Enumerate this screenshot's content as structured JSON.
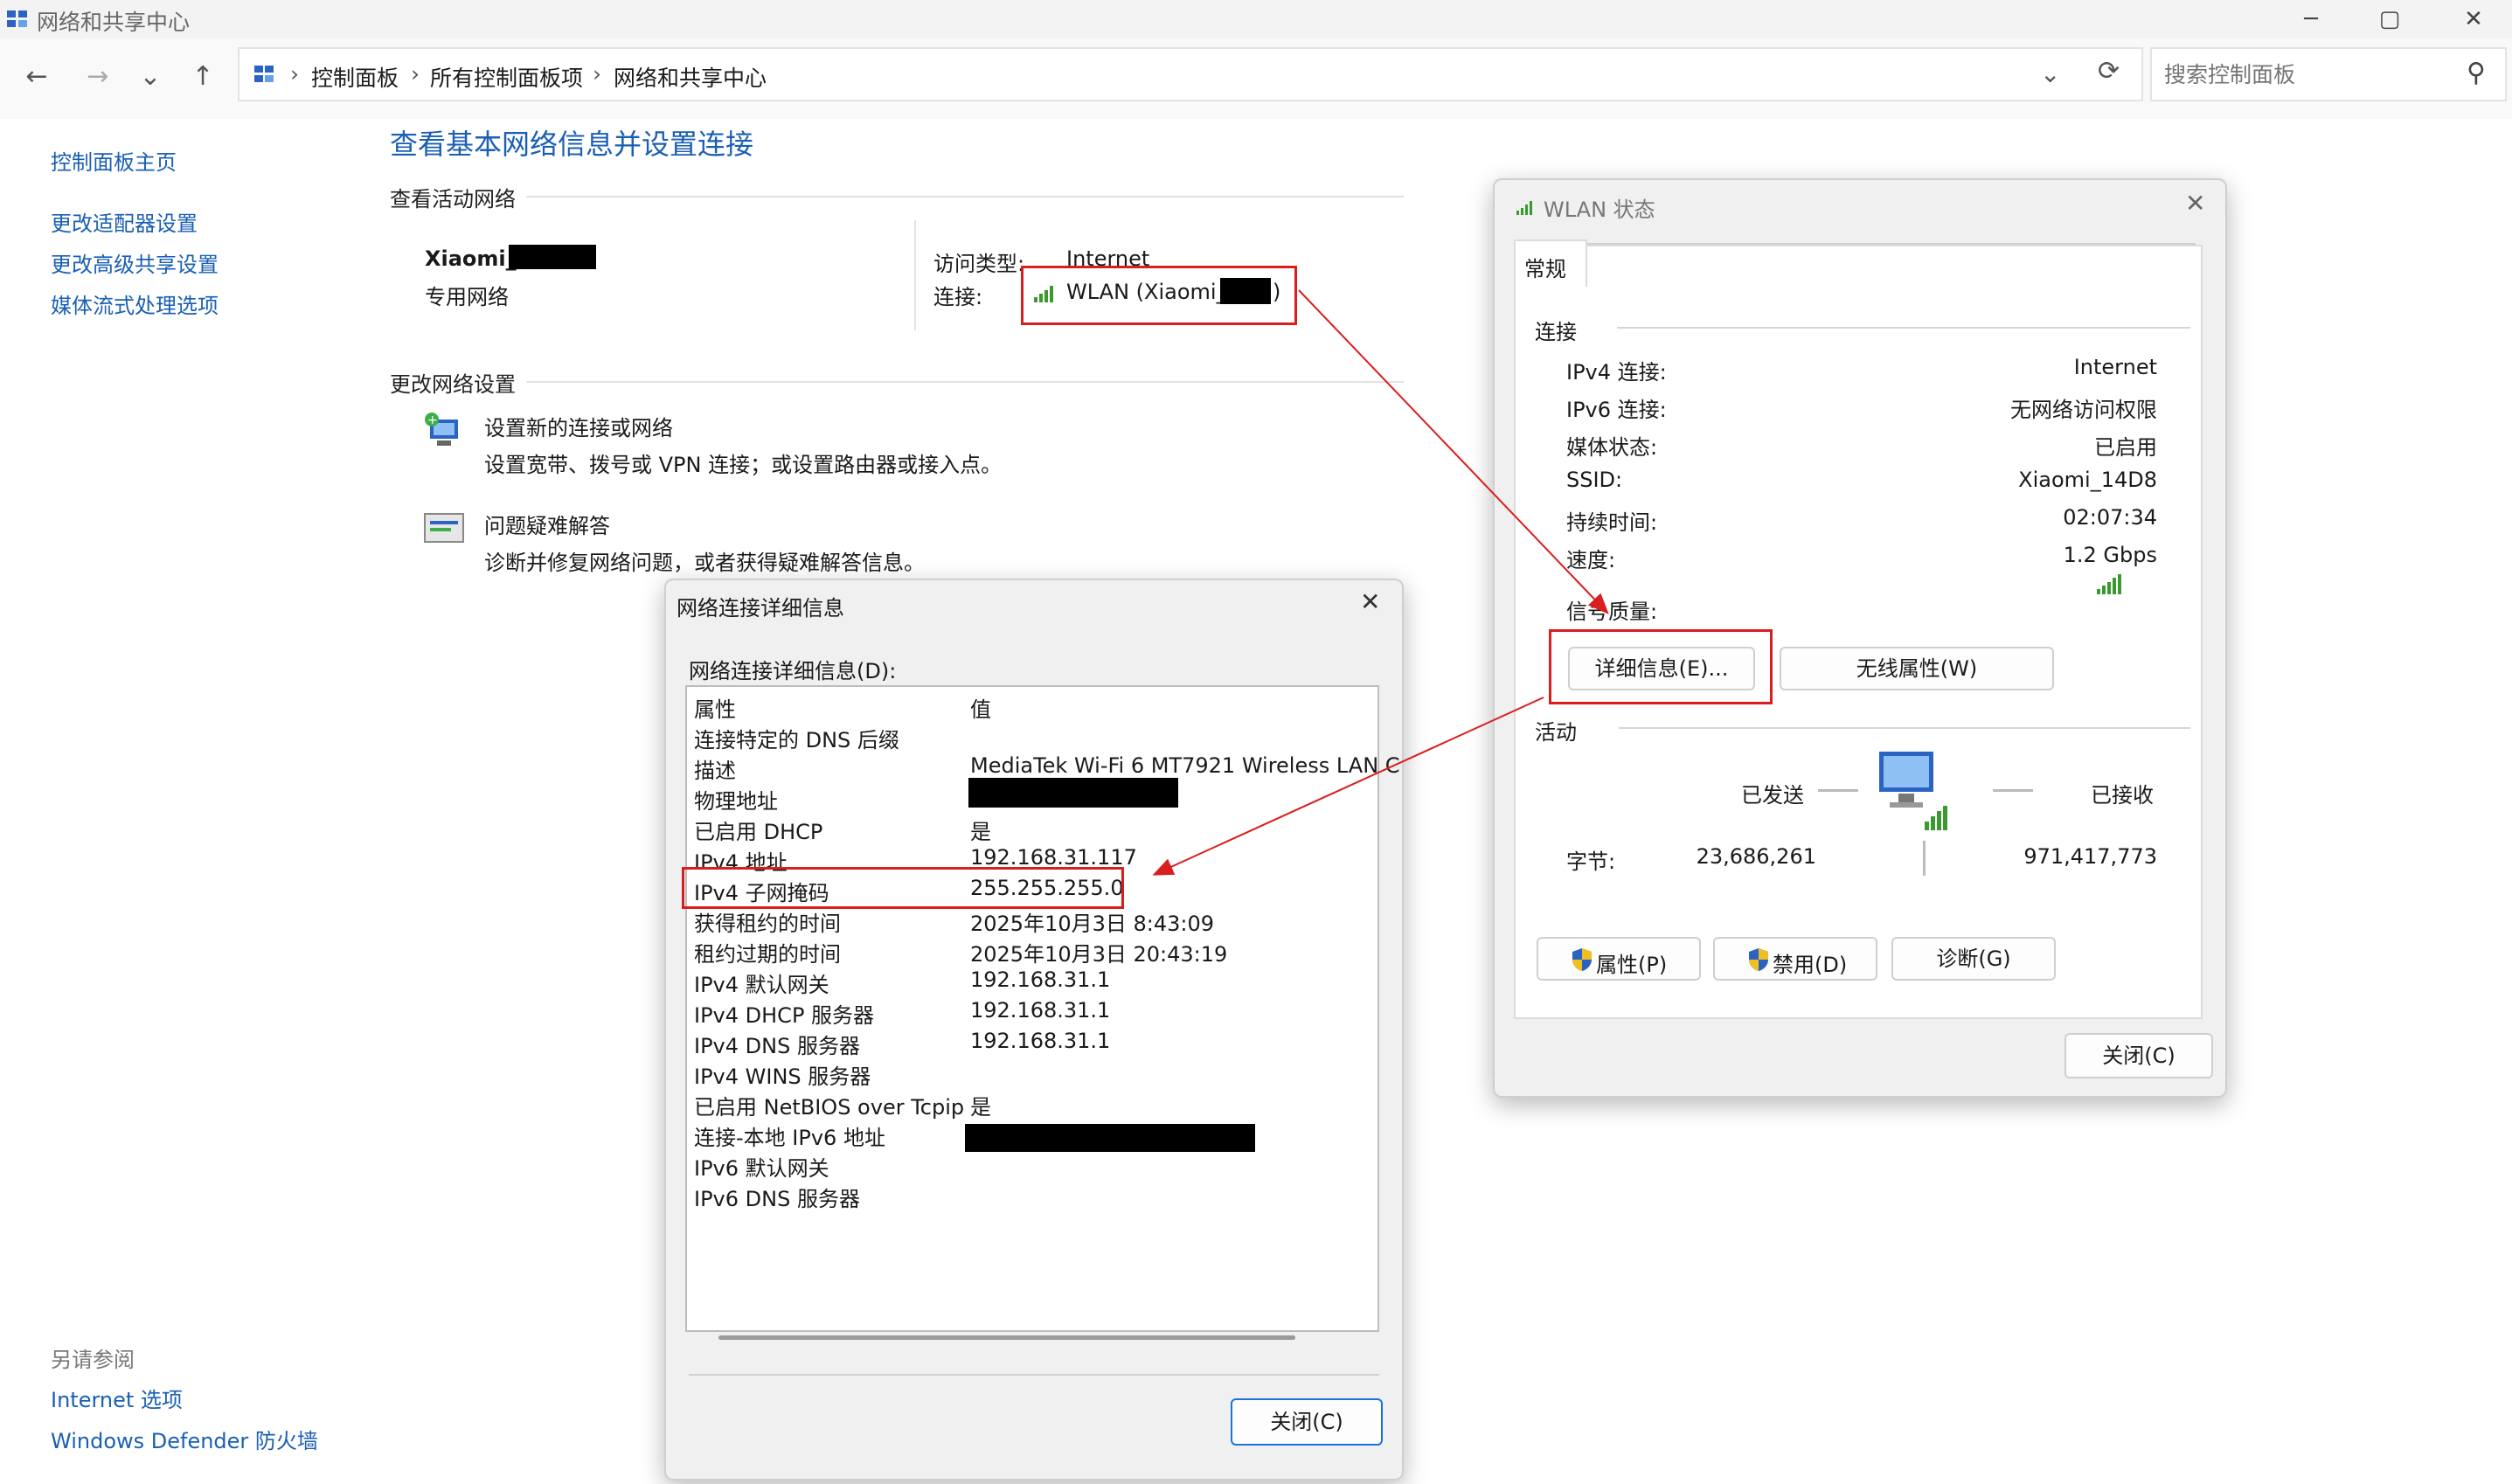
{
  "window": {
    "title": "网络和共享中心",
    "minimize": "─",
    "maximize": "▢",
    "close": "✕"
  },
  "nav": {
    "back": "←",
    "forward": "→",
    "recent": "⌄",
    "up": "↑",
    "breadcrumb": [
      "控制面板",
      "所有控制面板项",
      "网络和共享中心"
    ],
    "separator": "›",
    "dropdown": "⌄",
    "refresh": "⟳",
    "search_placeholder": "搜索控制面板",
    "search_icon": "⚲"
  },
  "sidebar": {
    "home": "控制面板主页",
    "items": [
      "更改适配器设置",
      "更改高级共享设置",
      "媒体流式处理选项"
    ],
    "see_also_title": "另请参阅",
    "see_also": [
      "Internet 选项",
      "Windows Defender 防火墙"
    ]
  },
  "main": {
    "title": "查看基本网络信息并设置连接",
    "active_networks_label": "查看活动网络",
    "network_name": "Xiaomi_",
    "network_type": "专用网络",
    "access_type_label": "访问类型:",
    "access_type_value": "Internet",
    "connection_label": "连接:",
    "connection_link_prefix": "WLAN (Xiaomi_",
    "connection_link_suffix": ")",
    "change_settings_label": "更改网络设置",
    "tasks": [
      {
        "title": "设置新的连接或网络",
        "desc": "设置宽带、拨号或 VPN 连接；或设置路由器或接入点。"
      },
      {
        "title": "问题疑难解答",
        "desc": "诊断并修复网络问题，或者获得疑难解答信息。"
      }
    ]
  },
  "details_dialog": {
    "title": "网络连接详细信息",
    "close": "✕",
    "list_label": "网络连接详细信息(D):",
    "header": {
      "k": "属性",
      "v": "值"
    },
    "rows": [
      {
        "k": "连接特定的 DNS 后缀",
        "v": ""
      },
      {
        "k": "描述",
        "v": "MediaTek Wi-Fi 6 MT7921 Wireless LAN C"
      },
      {
        "k": "物理地址",
        "v": ""
      },
      {
        "k": "已启用 DHCP",
        "v": "是"
      },
      {
        "k": "IPv4 地址",
        "v": "192.168.31.117"
      },
      {
        "k": "IPv4 子网掩码",
        "v": "255.255.255.0"
      },
      {
        "k": "获得租约的时间",
        "v": "2025年10月3日 8:43:09"
      },
      {
        "k": "租约过期的时间",
        "v": "2025年10月3日 20:43:19"
      },
      {
        "k": "IPv4 默认网关",
        "v": "192.168.31.1"
      },
      {
        "k": "IPv4 DHCP 服务器",
        "v": "192.168.31.1"
      },
      {
        "k": "IPv4 DNS 服务器",
        "v": "192.168.31.1"
      },
      {
        "k": "IPv4 WINS 服务器",
        "v": ""
      },
      {
        "k": "已启用 NetBIOS over Tcpip",
        "v": "是"
      },
      {
        "k": "连接-本地 IPv6 地址",
        "v": ""
      },
      {
        "k": "IPv6 默认网关",
        "v": ""
      },
      {
        "k": "IPv6 DNS 服务器",
        "v": ""
      }
    ],
    "close_button": "关闭(C)"
  },
  "wlan_dialog": {
    "title": "WLAN 状态",
    "close": "✕",
    "tab": "常规",
    "connection_section": "连接",
    "fields": [
      {
        "k": "IPv4 连接:",
        "v": "Internet"
      },
      {
        "k": "IPv6 连接:",
        "v": "无网络访问权限"
      },
      {
        "k": "媒体状态:",
        "v": "已启用"
      },
      {
        "k": "SSID:",
        "v": "Xiaomi_14D8"
      },
      {
        "k": "持续时间:",
        "v": "02:07:34"
      },
      {
        "k": "速度:",
        "v": "1.2 Gbps"
      }
    ],
    "signal_label": "信号质量:",
    "details_button": "详细信息(E)...",
    "wireless_props_button": "无线属性(W)",
    "activity_section": "活动",
    "sent_label": "已发送",
    "received_label": "已接收",
    "bytes_label": "字节:",
    "bytes_sent": "23,686,261",
    "bytes_received": "971,417,773",
    "properties_button": "属性(P)",
    "disable_button": "禁用(D)",
    "diagnose_button": "诊断(G)",
    "close_button": "关闭(C)"
  },
  "colors": {
    "link": "#1a5fb4",
    "annotation": "#d81e1e",
    "signal": "#3a9a2f"
  }
}
